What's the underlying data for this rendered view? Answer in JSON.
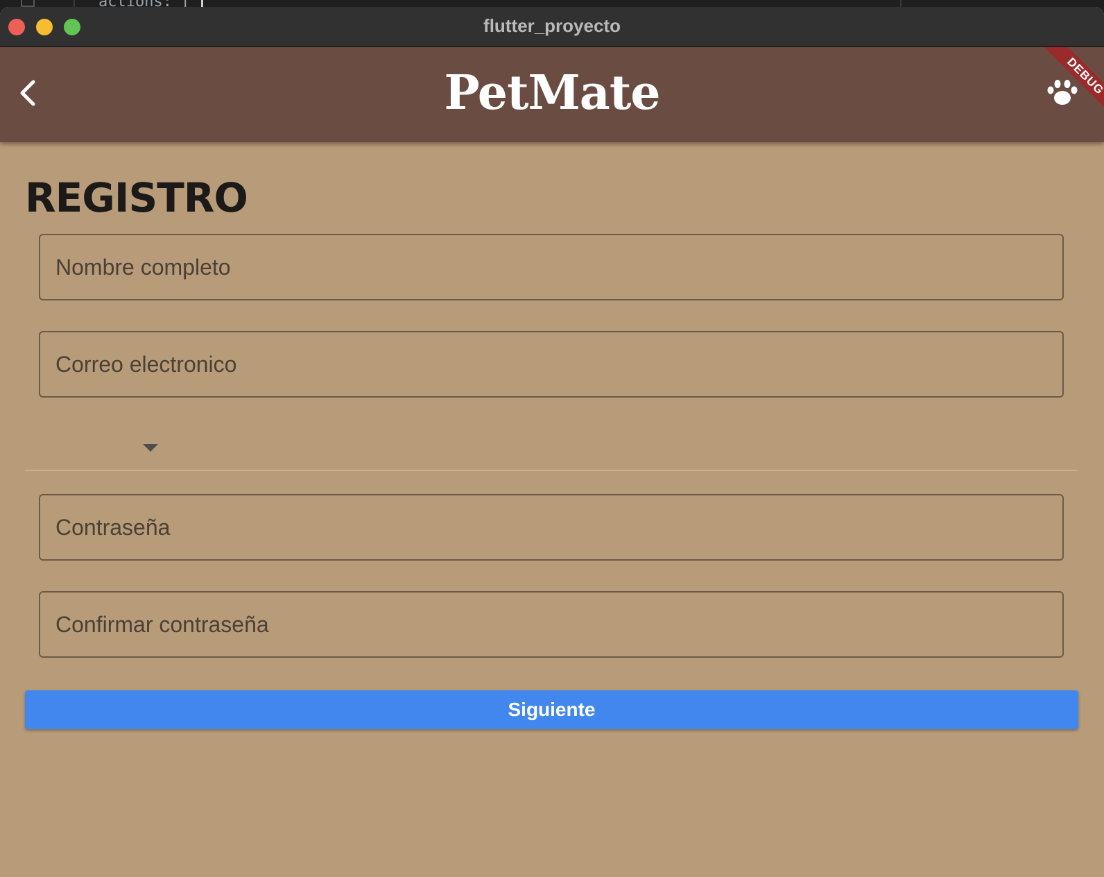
{
  "window": {
    "title": "flutter_proyecto",
    "background_code": "actions: ["
  },
  "appbar": {
    "title": "PetMate",
    "back_icon": "chevron-left-icon",
    "action_icon": "paw-icon",
    "debug_banner": "DEBUG",
    "color": "#6a4c43"
  },
  "form": {
    "heading": "REGISTRO",
    "full_name": {
      "placeholder": "Nombre completo",
      "value": ""
    },
    "email": {
      "placeholder": "Correo electronico",
      "value": ""
    },
    "select": {
      "value": "",
      "icon": "dropdown-arrow-icon"
    },
    "password": {
      "placeholder": "Contraseña",
      "value": ""
    },
    "confirm_password": {
      "placeholder": "Confirmar contraseña",
      "value": ""
    },
    "submit_label": "Siguiente"
  },
  "colors": {
    "background": "#b89c79",
    "button": "#4287ed",
    "debug": "#9b2a2a"
  }
}
